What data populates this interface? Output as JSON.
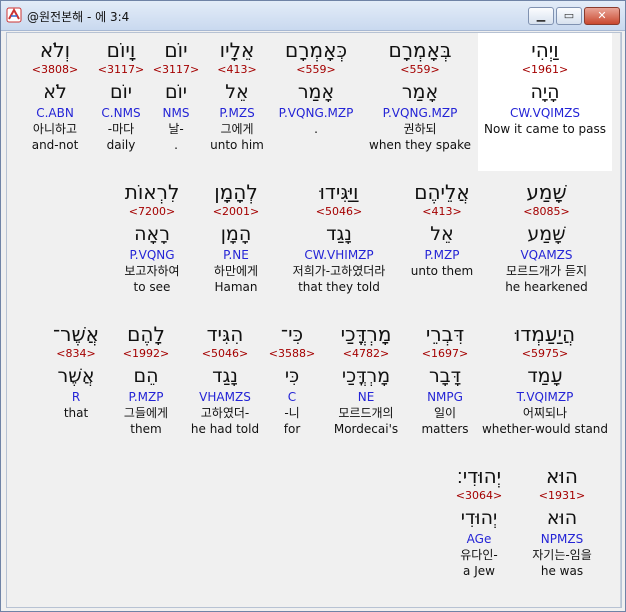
{
  "window": {
    "title": "@원전본해 - 에 3:4",
    "min_glyph": "▁",
    "max_glyph": "▭",
    "close_glyph": "✕"
  },
  "rows": [
    {
      "words": [
        {
          "heb": "וַיְהִי",
          "num": "<1961>",
          "lemma": "הָיָה",
          "parse": "CW.VQIMZS",
          "kor": "",
          "eng": "Now it came to pass"
        },
        {
          "heb": "בְּאָמְרָם",
          "num": "<559>",
          "lemma": "אָמַר",
          "parse": "P.VQNG.MZP",
          "kor": "권하되",
          "eng": "when they spake"
        },
        {
          "heb": "כְּאָמְרָם",
          "num": "<559>",
          "lemma": "אָמַר",
          "parse": "P.VQNG.MZP",
          "kor": "",
          "eng": "."
        },
        {
          "heb": "אֵלָיו",
          "num": "<413>",
          "lemma": "אֵל",
          "parse": "P.MZS",
          "kor": "그에게",
          "eng": "unto him"
        },
        {
          "heb": "יוֹם",
          "num": "<3117>",
          "lemma": "יוֹם",
          "parse": "NMS",
          "kor": "날-",
          "eng": "."
        },
        {
          "heb": "וָיוֹם",
          "num": "<3117>",
          "lemma": "יוֹם",
          "parse": "C.NMS",
          "kor": "-마다",
          "eng": "daily"
        },
        {
          "heb": "וְלֹא",
          "num": "<3808>",
          "lemma": "לֹא",
          "parse": "C.ABN",
          "kor": "아니하고",
          "eng": "and-not"
        }
      ]
    },
    {
      "words": [
        {
          "heb": "שָׁמַע",
          "num": "<8085>",
          "lemma": "שָׁמַע",
          "parse": "VQAMZS",
          "kor": "모르드개가 듣지",
          "eng": "he hearkened"
        },
        {
          "heb": "אֲלֵיהֶם",
          "num": "<413>",
          "lemma": "אֵל",
          "parse": "P.MZP",
          "kor": "",
          "eng": "unto them"
        },
        {
          "heb": "וַיַּגִּידוּ",
          "num": "<5046>",
          "lemma": "נָגַד",
          "parse": "CW.VHIMZP",
          "kor": "저희가-고하였더라",
          "eng": "that they told"
        },
        {
          "heb": "לְהָמָן",
          "num": "<2001>",
          "lemma": "הָמָן",
          "parse": "P.NE",
          "kor": "하만에게",
          "eng": "Haman"
        },
        {
          "heb": "לִרְאוֹת",
          "num": "<7200>",
          "lemma": "רָאָה",
          "parse": "P.VQNG",
          "kor": "보고자하여",
          "eng": "to see"
        }
      ]
    },
    {
      "words": [
        {
          "heb": "הֲיַעַמְדוּ",
          "num": "<5975>",
          "lemma": "עָמַד",
          "parse": "T.VQIMZP",
          "kor": "어찌되나",
          "eng": "whether-would stand"
        },
        {
          "heb": "דִּבְרֵי",
          "num": "<1697>",
          "lemma": "דָּבָר",
          "parse": "NMPG",
          "kor": "일이",
          "eng": "matters"
        },
        {
          "heb": "מָרְדֳּכַי",
          "num": "<4782>",
          "lemma": "מָרְדֳּכַי",
          "parse": "NE",
          "kor": "모르드개의",
          "eng": "Mordecai's"
        },
        {
          "heb": "כִּי־",
          "num": "<3588>",
          "lemma": "כִּי",
          "parse": "C",
          "kor": "-니",
          "eng": "for"
        },
        {
          "heb": "הִגִּיד",
          "num": "<5046>",
          "lemma": "נָגַד",
          "parse": "VHAMZS",
          "kor": "고하였더-",
          "eng": "he had told"
        },
        {
          "heb": "לָהֶם",
          "num": "<1992>",
          "lemma": "הֵם",
          "parse": "P.MZP",
          "kor": "그들에게",
          "eng": "them"
        },
        {
          "heb": "אֲשֶׁר־",
          "num": "<834>",
          "lemma": "אֲשֶׁר",
          "parse": "R",
          "kor": "",
          "eng": "that"
        }
      ]
    },
    {
      "words": [
        {
          "heb": "הוּא",
          "num": "<1931>",
          "lemma": "הוּא",
          "parse": "NPMZS",
          "kor": "자기는-임을",
          "eng": "he was"
        },
        {
          "heb": "יְהוּדִי׃",
          "num": "<3064>",
          "lemma": "יְהוּדִי",
          "parse": "AGe",
          "kor": "유다인-",
          "eng": "a Jew"
        }
      ]
    }
  ]
}
